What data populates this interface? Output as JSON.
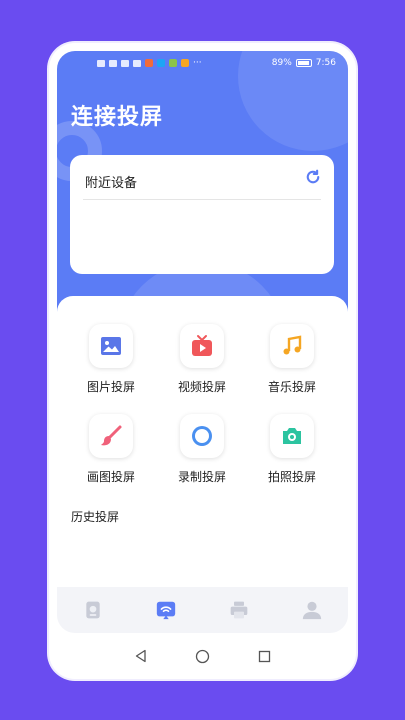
{
  "statusbar": {
    "battery": "89%",
    "time": "7:56",
    "battery_level": 0.89,
    "app_icon_colors": [
      "#f26b3a",
      "#1ea5f5",
      "#8bc34a",
      "#f5a623"
    ]
  },
  "page": {
    "title": "连接投屏"
  },
  "devices": {
    "title": "附近设备",
    "refresh_icon": "refresh-icon"
  },
  "features": [
    {
      "label": "图片投屏",
      "icon": "image-icon",
      "color": "#5a76e8"
    },
    {
      "label": "视频投屏",
      "icon": "tv-play-icon",
      "color": "#f0575a"
    },
    {
      "label": "音乐投屏",
      "icon": "music-note-icon",
      "color": "#f5a623"
    },
    {
      "label": "画图投屏",
      "icon": "brush-icon",
      "color": "#f0617a"
    },
    {
      "label": "录制投屏",
      "icon": "record-circle-icon",
      "color": "#4a90f0"
    },
    {
      "label": "拍照投屏",
      "icon": "camera-icon",
      "color": "#2cc4a0"
    }
  ],
  "history": {
    "title": "历史投屏"
  },
  "tabs": [
    {
      "icon": "device-icon",
      "active": false
    },
    {
      "icon": "cast-icon",
      "active": true
    },
    {
      "icon": "printer-icon",
      "active": false
    },
    {
      "icon": "user-icon",
      "active": false
    }
  ],
  "colors": {
    "accent": "#5b7cf5",
    "background": "#6a4cf0",
    "tab_inactive": "#c8cbd6"
  }
}
